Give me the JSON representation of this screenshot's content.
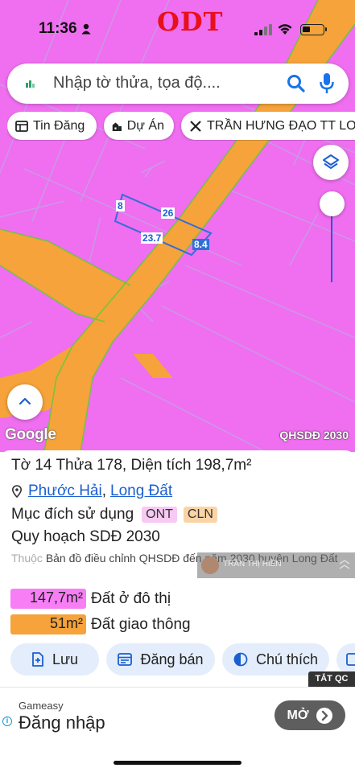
{
  "status": {
    "time": "11:36",
    "overlay": "ODT"
  },
  "search": {
    "placeholder": "Nhập tờ thửa, tọa độ...."
  },
  "chips": [
    {
      "label": "Tin Đăng",
      "icon": "newspaper-icon"
    },
    {
      "label": "Dự Án",
      "icon": "buildings-icon"
    },
    {
      "label": "TRẦN HƯNG ĐẠO TT LO",
      "icon": "road-icon"
    }
  ],
  "map": {
    "edge_labels": [
      "8",
      "26",
      "23.7",
      "8.4"
    ],
    "watermark": "Google",
    "layer_name": "QHSDĐ 2030",
    "colors": {
      "residential": "#f06ef0",
      "traffic": "#f5a33a",
      "parcel_outline": "#2f6fd8"
    }
  },
  "parcel": {
    "title_prefix": "Tờ",
    "sheet": "14",
    "plot_prefix": "Thửa",
    "plot": "178",
    "area_prefix": ", Diện tích",
    "area": "198,7m²",
    "ward": "Phước Hải",
    "district": "Long Đất",
    "purpose_label": "Mục đích sử dụng",
    "purpose_tags": [
      "ONT",
      "CLN"
    ],
    "plan_label": "Quy hoạch SDĐ 2030",
    "belong_prefix": "Thuộc",
    "belong_text": "Bản đồ điều chỉnh QHSDĐ đến năm 2030 huyện Long Đất",
    "areas": [
      {
        "value": "147,7m²",
        "label": "Đất ở đô thị",
        "color": "#f77ef5"
      },
      {
        "value": "51m²",
        "label": "Đất giao thông",
        "color": "#f5a33a"
      }
    ]
  },
  "overlay_user": {
    "name": "TRẦN THỊ HIỀN"
  },
  "actions": [
    {
      "label": "Lưu",
      "icon": "save-icon"
    },
    {
      "label": "Đăng bán",
      "icon": "listing-icon"
    },
    {
      "label": "Chú thích",
      "icon": "legend-icon"
    }
  ],
  "ad": {
    "close_label": "TẮT QC",
    "brand": "Gameasy",
    "headline": "Đăng nhập",
    "button": "MỞ"
  }
}
